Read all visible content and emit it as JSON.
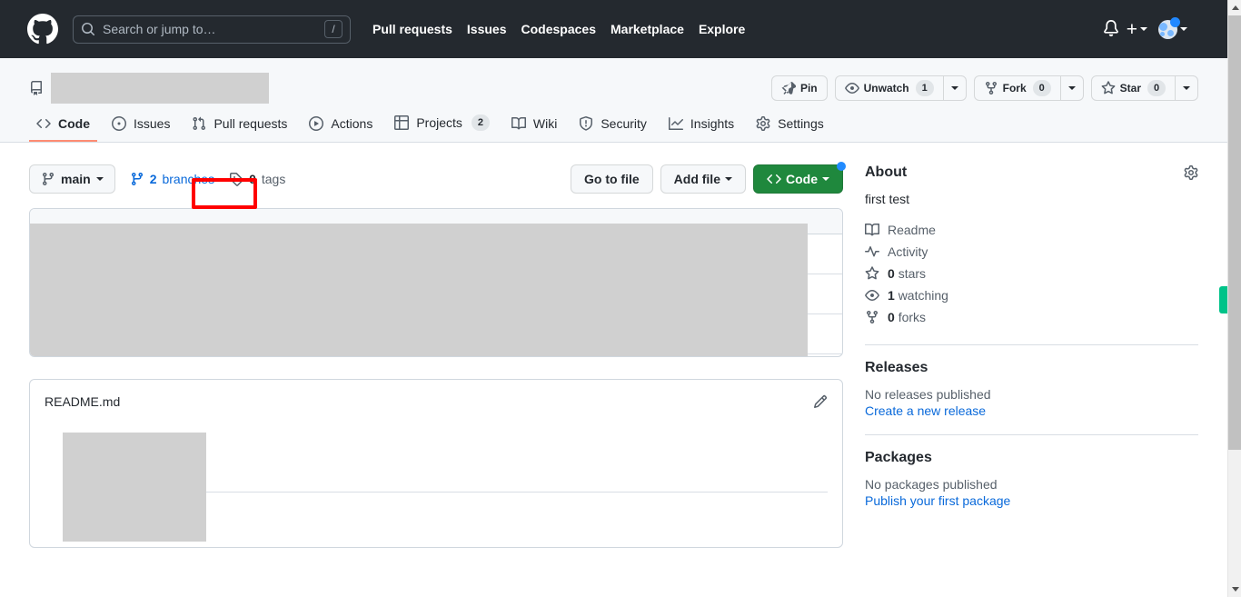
{
  "global_header": {
    "logo_icon": "github-mark-icon",
    "search": {
      "icon": "search-icon",
      "placeholder": "Search or jump to…",
      "value": "",
      "shortcut_key": "/"
    },
    "nav": [
      {
        "label": "Pull requests"
      },
      {
        "label": "Issues"
      },
      {
        "label": "Codespaces"
      },
      {
        "label": "Marketplace"
      },
      {
        "label": "Explore"
      }
    ],
    "notifications_icon": "bell-icon",
    "create_new": {
      "label": "+",
      "caret_icon": "chevron-down-icon"
    },
    "avatar": {
      "icon": "avatar",
      "caret_icon": "chevron-down-icon",
      "status_icon": "status-dot"
    }
  },
  "repo_header": {
    "repo_icon": "repository-icon",
    "repo_name": "",
    "actions": {
      "pin": {
        "label": "Pin",
        "icon": "pin-icon"
      },
      "watch": {
        "label": "Unwatch",
        "icon": "eye-icon",
        "count": "1",
        "caret_icon": "chevron-down-icon"
      },
      "fork": {
        "label": "Fork",
        "icon": "fork-icon",
        "count": "0",
        "caret_icon": "chevron-down-icon"
      },
      "star": {
        "label": "Star",
        "icon": "star-icon",
        "count": "0",
        "caret_icon": "chevron-down-icon"
      }
    },
    "tabs": [
      {
        "label": "Code",
        "icon": "code-icon",
        "count": null,
        "active": true
      },
      {
        "label": "Issues",
        "icon": "issue-opened-icon",
        "count": null,
        "active": false
      },
      {
        "label": "Pull requests",
        "icon": "git-pull-request-icon",
        "count": null,
        "active": false
      },
      {
        "label": "Actions",
        "icon": "play-icon",
        "count": null,
        "active": false
      },
      {
        "label": "Projects",
        "icon": "table-icon",
        "count": "2",
        "active": false
      },
      {
        "label": "Wiki",
        "icon": "book-icon",
        "count": null,
        "active": false
      },
      {
        "label": "Security",
        "icon": "shield-icon",
        "count": null,
        "active": false
      },
      {
        "label": "Insights",
        "icon": "graph-icon",
        "count": null,
        "active": false
      },
      {
        "label": "Settings",
        "icon": "gear-icon",
        "count": null,
        "active": false
      }
    ]
  },
  "file_toolbar": {
    "branch_button": {
      "label": "main",
      "icon": "branch-icon",
      "caret_icon": "chevron-down-icon"
    },
    "branches": {
      "count": "2",
      "label": "branches",
      "icon": "branch-icon",
      "highlighted": true
    },
    "tags": {
      "count": "0",
      "label": "tags",
      "icon": "tag-icon"
    },
    "go_to_file": {
      "label": "Go to file"
    },
    "add_file": {
      "label": "Add file",
      "caret_icon": "chevron-down-icon"
    },
    "code_button": {
      "label": "Code",
      "icon": "code-icon",
      "caret_icon": "chevron-down-icon",
      "badge": "update-dot",
      "color": "#1f883d"
    }
  },
  "readme": {
    "title": "README.md",
    "edit_icon": "pencil-icon"
  },
  "sidebar": {
    "about": {
      "heading": "About",
      "settings_icon": "gear-icon",
      "description": "first test",
      "links": [
        {
          "label": "Readme",
          "icon": "book-icon"
        },
        {
          "label": "Activity",
          "icon": "pulse-icon"
        },
        {
          "label": "0 stars",
          "icon": "star-icon",
          "value": "0",
          "noun": "stars"
        },
        {
          "label": "1 watching",
          "icon": "eye-icon",
          "value": "1",
          "noun": "watching"
        },
        {
          "label": "0 forks",
          "icon": "fork-icon",
          "value": "0",
          "noun": "forks"
        }
      ]
    },
    "releases": {
      "heading": "Releases",
      "empty_text": "No releases published",
      "action_link": "Create a new release"
    },
    "packages": {
      "heading": "Packages",
      "empty_text": "No packages published",
      "action_link": "Publish your first package"
    }
  },
  "annotation": {
    "highlight_color": "#ff0000",
    "target": "branches"
  },
  "scrollbar": {
    "up_icon": "triangle-up-icon",
    "down_icon": "triangle-down-icon"
  }
}
